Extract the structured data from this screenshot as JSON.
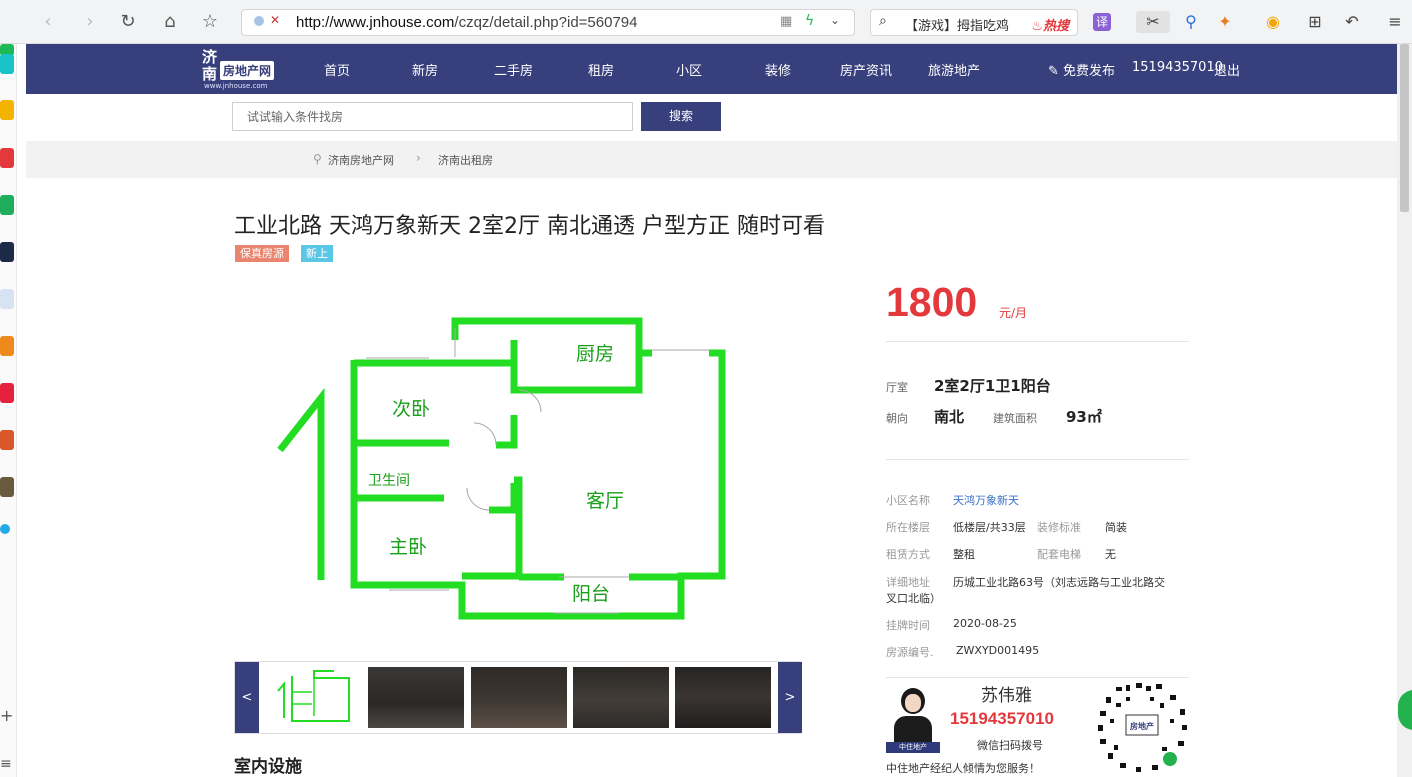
{
  "browser": {
    "url_host": "http://www.jnhouse.com",
    "url_path": "/czqz/detail.php?id=560794",
    "search_suggestion": "【游戏】拇指吃鸡",
    "hot_label": "热搜",
    "translate_label": "译"
  },
  "site": {
    "logo_big": "济南",
    "logo_box": "房地产网",
    "logo_url": "www.jnhouse.com",
    "nav": [
      "首页",
      "新房",
      "二手房",
      "租房",
      "小区",
      "装修",
      "房产资讯",
      "旅游地产"
    ],
    "publish_label": "免费发布",
    "user_phone": "15194357010",
    "logout_label": "退出",
    "search_placeholder": "试试输入条件找房",
    "search_button": "搜索",
    "breadcrumb": [
      "济南房地产网",
      "济南出租房"
    ]
  },
  "listing": {
    "title": "工业北路 天鸿万象新天 2室2厅 南北通透 户型方正 随时可看",
    "tags": [
      {
        "label": "保真房源",
        "color": "#e9856f"
      },
      {
        "label": "新上",
        "color": "#5bc7e6"
      }
    ],
    "price": "1800",
    "price_unit": "元/月",
    "layout_label": "厅室",
    "layout_value": "2室2厅1卫1阳台",
    "orientation_label": "朝向",
    "orientation_value": "南北",
    "area_label": "建筑面积",
    "area_value": "93㎡",
    "community_label": "小区名称",
    "community_value": "天鸿万象新天",
    "floor_label": "所在楼层",
    "floor_value": "低楼层/共33层",
    "decoration_label": "装修标准",
    "decoration_value": "简装",
    "rent_type_label": "租赁方式",
    "rent_type_value": "整租",
    "elevator_label": "配套电梯",
    "elevator_value": "无",
    "address_label": "详细地址",
    "address_line1": "历城工业北路63号（刘志远路与工业北路交",
    "address_line2": "叉口北临）",
    "listed_label": "挂牌时间",
    "listed_value": "2020-08-25",
    "code_label": "房源编号.",
    "code_value": "ZWXYD001495",
    "facility_heading": "室内设施"
  },
  "floorplan": {
    "rooms": [
      "厨房",
      "次卧",
      "卫生间",
      "客厅",
      "主卧",
      "阳台"
    ]
  },
  "gallery": {
    "prev": "<",
    "next": ">"
  },
  "agent": {
    "name": "苏伟雅",
    "phone": "15194357010",
    "qr_hint": "微信扫码拨号",
    "slogan": "中住地产经纪人倾情为您服务！",
    "photo_caption": "中住地产",
    "qr_logo": "房地产"
  }
}
